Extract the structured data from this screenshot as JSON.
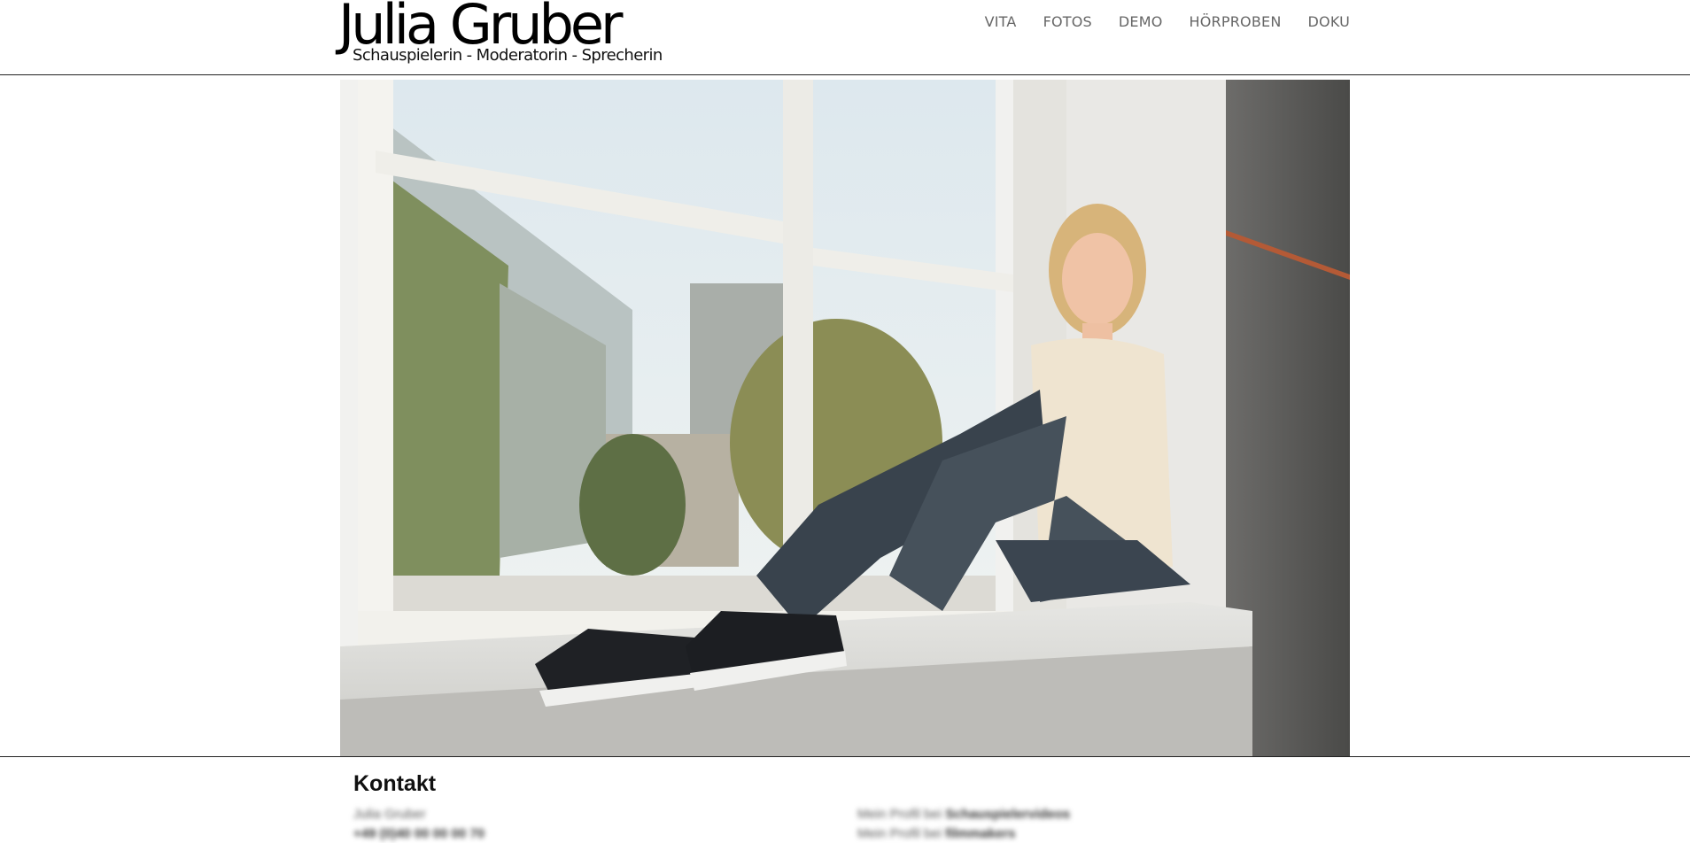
{
  "site": {
    "title": "Julia Gruber",
    "subtitle": "Schauspielerin - Moderatorin - Sprecherin"
  },
  "nav": {
    "items": [
      {
        "label": "VITA"
      },
      {
        "label": "FOTOS"
      },
      {
        "label": "DEMO"
      },
      {
        "label": "HÖRPROBEN"
      },
      {
        "label": "DOKU"
      }
    ]
  },
  "hero": {
    "alt": "Julia Gruber sitzt lächelnd auf einer Fensterbank"
  },
  "footer": {
    "heading": "Kontakt",
    "left": {
      "name": "Julia Gruber",
      "phone": "+49 (0)40 00 00 00 70"
    },
    "right": {
      "line1_prefix": "Mein Profil bei",
      "line1_link": "Schauspielervideos",
      "line2_prefix": "Mein Profil bei",
      "line2_link": "filmmakers"
    }
  },
  "colors": {
    "nav_text": "#666666",
    "divider": "#222222"
  }
}
